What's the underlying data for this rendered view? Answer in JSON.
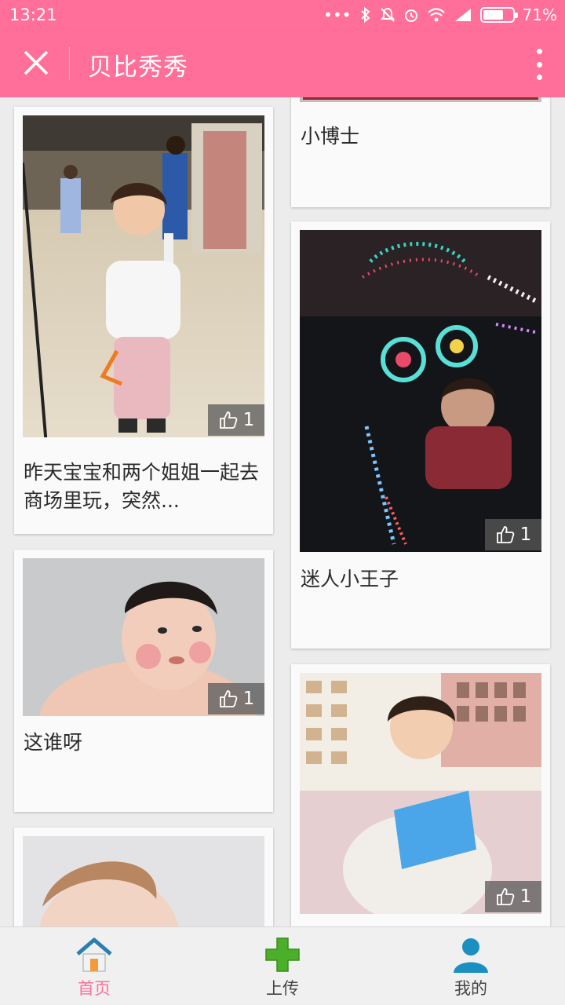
{
  "status_bar": {
    "time": "13:21",
    "icons": [
      "dots-icon",
      "bluetooth-icon",
      "mute-icon",
      "alarm-icon",
      "wifi-icon",
      "signal-icon",
      "battery-icon"
    ],
    "battery": "71%",
    "battery_level": 0.71
  },
  "app_bar": {
    "title": "贝比秀秀",
    "close_icon": "close-icon",
    "menu_icon": "more-vert-icon",
    "background": "#ff6f9a"
  },
  "posts_left": [
    {
      "caption": "昨天宝宝和两个姐姐一起去商场里玩，突然...",
      "likes": "1"
    },
    {
      "caption": "这谁呀",
      "likes": "1"
    },
    {
      "caption": "",
      "likes": ""
    }
  ],
  "posts_right": [
    {
      "caption": "小博士",
      "likes": ""
    },
    {
      "caption": "迷人小王子",
      "likes": "1"
    },
    {
      "caption": "",
      "likes": "1"
    }
  ],
  "bottom_nav": [
    {
      "label": "首页",
      "icon": "home-icon",
      "active": true
    },
    {
      "label": "上传",
      "icon": "plus-icon",
      "active": false
    },
    {
      "label": "我的",
      "icon": "user-icon",
      "active": false
    }
  ],
  "colors": {
    "accent": "#ff6f9a",
    "upload_green": "#4caf2a",
    "profile_blue": "#1a8fc0"
  }
}
